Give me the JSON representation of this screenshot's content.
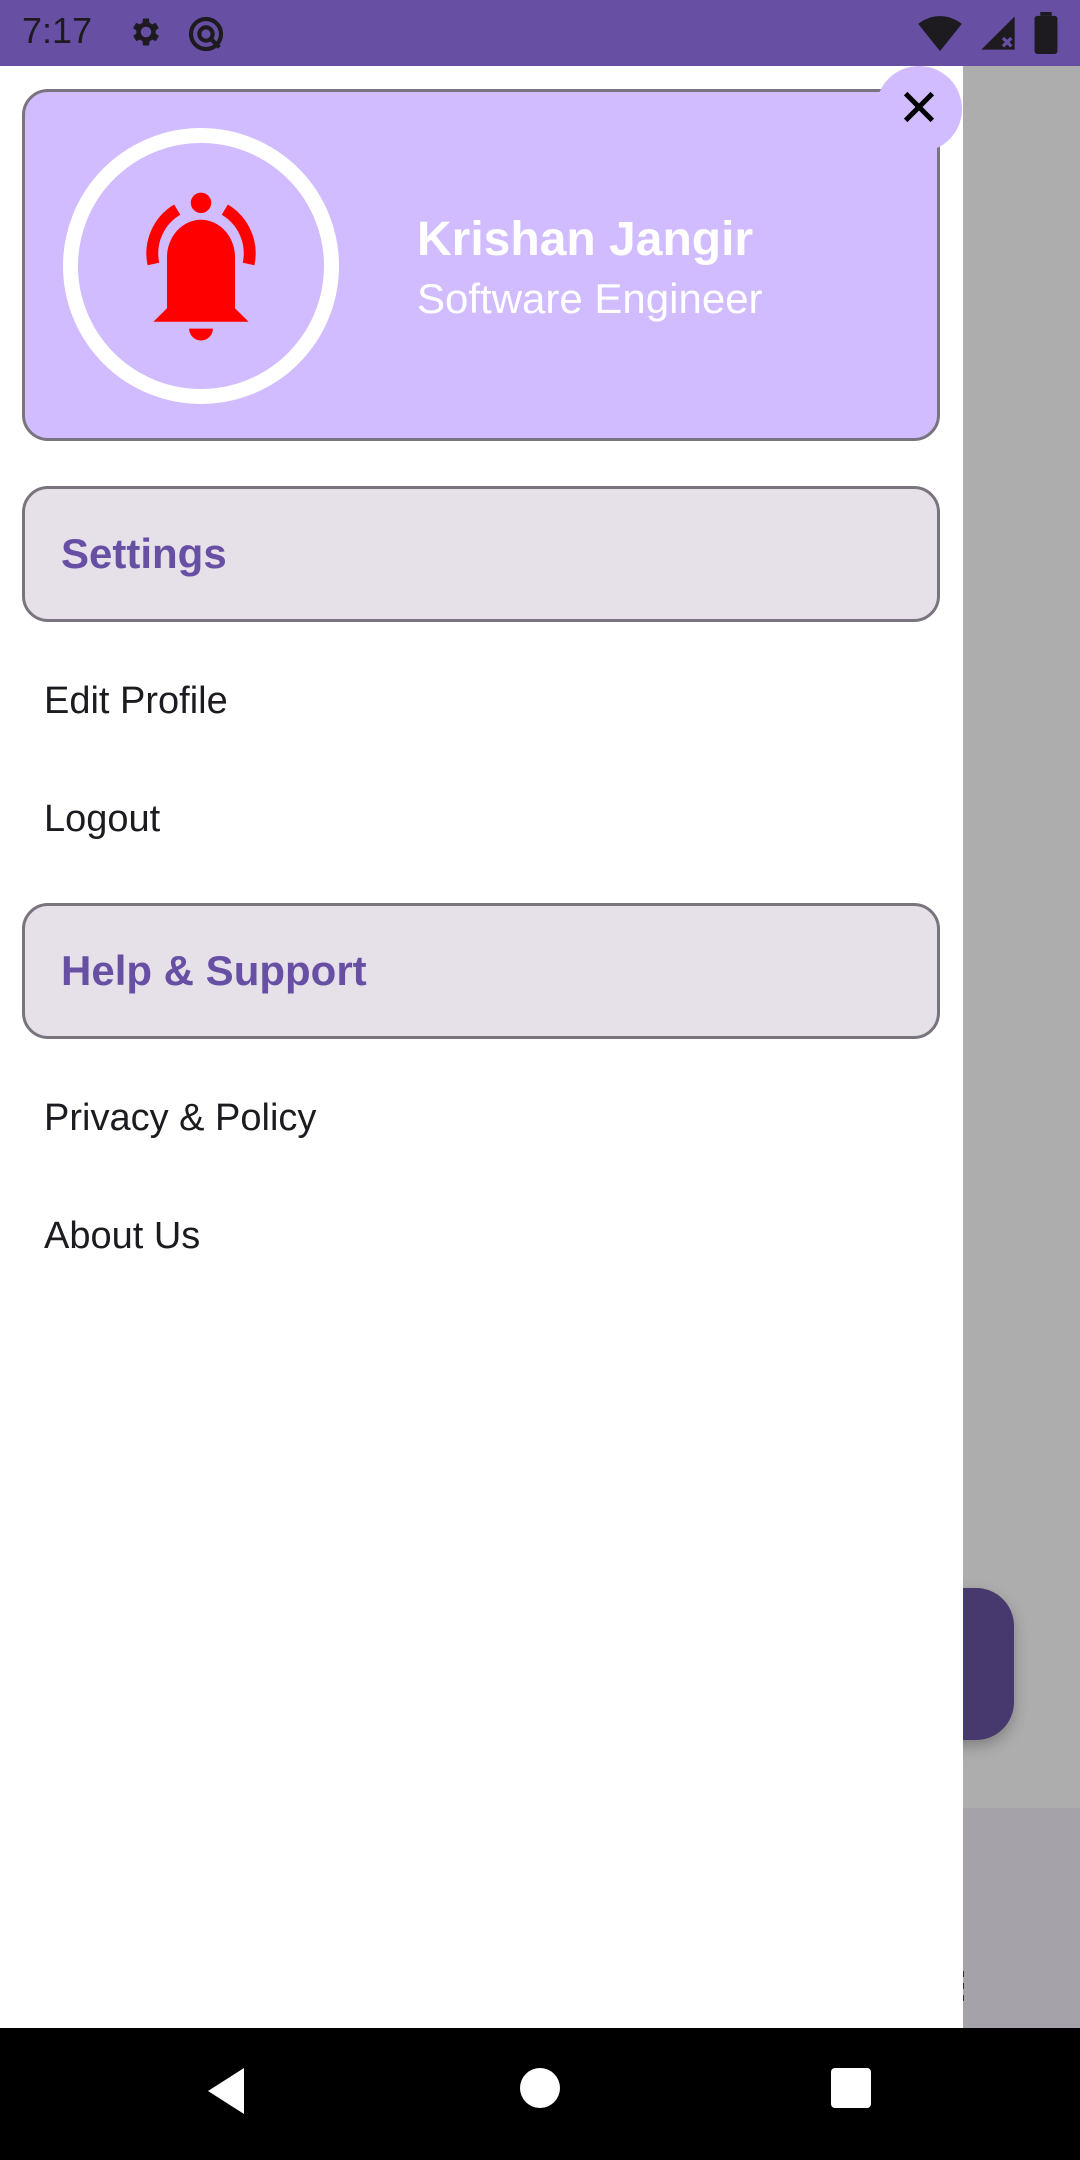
{
  "status_bar": {
    "time": "7:17",
    "icons": [
      "gear-icon",
      "sync-icon",
      "wifi-icon",
      "signal-icon",
      "battery-icon"
    ]
  },
  "drawer": {
    "profile": {
      "name": "Krishan Jangir",
      "role": "Software Engineer",
      "avatar_icon": "bell-ringing-icon",
      "avatar_color": "#ff0000"
    },
    "close_icon": "close-icon",
    "sections": [
      {
        "title": "Settings",
        "items": [
          "Edit Profile",
          "Logout"
        ]
      },
      {
        "title": "Help & Support",
        "items": [
          "Privacy & Policy",
          "About Us"
        ]
      }
    ]
  },
  "nav_bar": {
    "buttons": [
      "back-icon",
      "home-icon",
      "recents-icon"
    ]
  },
  "colors": {
    "primary": "#6750a4",
    "profile_bg": "#d0bcff",
    "section_bg": "#e6e0e9",
    "scrim": "#adadad"
  }
}
